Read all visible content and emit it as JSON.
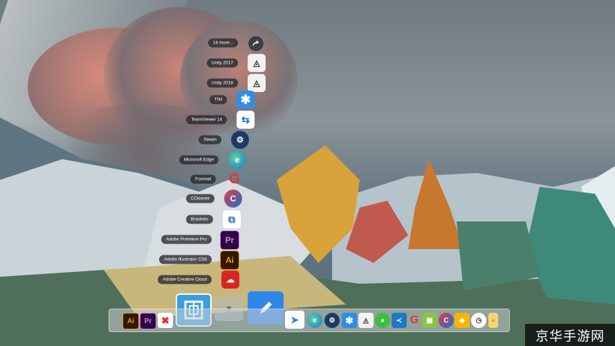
{
  "stack_menu": {
    "items": [
      {
        "label": "18 more...",
        "icon": "arrow-icon"
      },
      {
        "label": "Unity 2017",
        "icon": "unity-icon"
      },
      {
        "label": "Unity 2018",
        "icon": "unity-icon"
      },
      {
        "label": "TIM",
        "icon": "tim-icon"
      },
      {
        "label": "TeamViewer 14",
        "icon": "teamviewer-icon"
      },
      {
        "label": "Steam",
        "icon": "steam-icon"
      },
      {
        "label": "Microsoft Edge",
        "icon": "edge-icon"
      },
      {
        "label": "Foxmail",
        "icon": "foxmail-icon"
      },
      {
        "label": "CCleaner",
        "icon": "ccleaner-icon"
      },
      {
        "label": "Brackets",
        "icon": "brackets-icon"
      },
      {
        "label": "Adobe Premiere Pro",
        "icon": "premiere-icon",
        "glyph": "Pr"
      },
      {
        "label": "Adobe Illustrator CS6",
        "icon": "illustrator-icon",
        "glyph": "Ai"
      },
      {
        "label": "Adobe Creative Cloud",
        "icon": "creative-cloud-icon"
      }
    ]
  },
  "dock": {
    "left_icons": [
      {
        "name": "illustrator-icon",
        "glyph": "Ai"
      },
      {
        "name": "premiere-icon",
        "glyph": "Pr"
      },
      {
        "name": "xmind-icon",
        "glyph": "✖"
      }
    ],
    "right_icons": [
      "feishu-icon",
      "edge-icon",
      "steam-icon",
      "tim-icon",
      "unity-icon",
      "wechat-icon",
      "vscode-icon",
      "foxmail-icon",
      "android-icon",
      "ccleaner-icon",
      "sketch-icon",
      "clock-icon",
      "notes-icon"
    ]
  },
  "watermark": {
    "text": "京华手游网"
  }
}
